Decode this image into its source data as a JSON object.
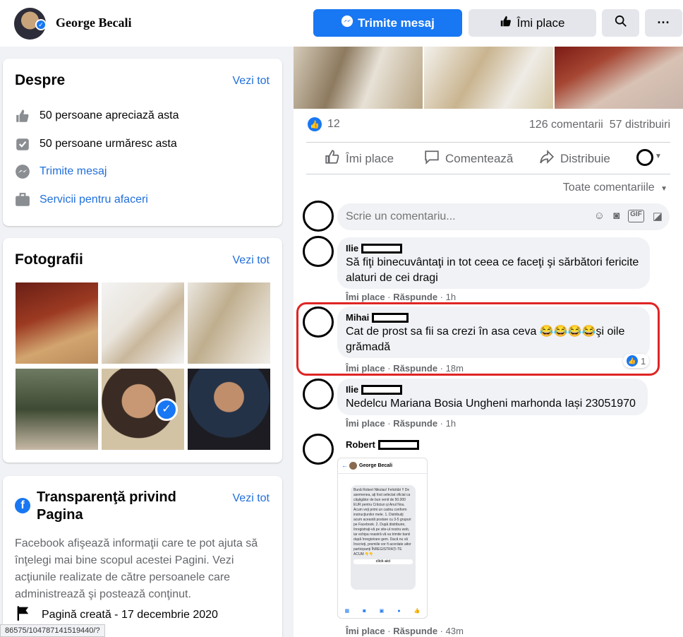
{
  "header": {
    "page_name": "George Becali",
    "send_message_label": "Trimite mesaj",
    "like_label": "Îmi place"
  },
  "about": {
    "title": "Despre",
    "see_all": "Vezi tot",
    "rows": [
      {
        "icon": "thumbs-up-icon",
        "text": "50 persoane apreciază asta"
      },
      {
        "icon": "follow-icon",
        "text": "50 persoane urmăresc asta"
      },
      {
        "icon": "messenger-icon",
        "text": "Trimite mesaj"
      },
      {
        "icon": "briefcase-icon",
        "text": "Servicii pentru afaceri"
      }
    ]
  },
  "photos": {
    "title": "Fotografii",
    "see_all": "Vezi tot"
  },
  "transparency": {
    "title": "Transparenţă privind Pagina",
    "see_all": "Vezi tot",
    "description": "Facebook afişează informaţii care te pot ajuta să înţelegi mai bine scopul acestei Pagini. Vezi acţiunile realizate de către persoanele care administrează şi postează conţinut.",
    "created": "Pagină creată - 17 decembrie 2020"
  },
  "post": {
    "like_count": "12",
    "comments_count": "126 comentarii",
    "shares_count": "57 distribuiri",
    "actions": {
      "like": "Îmi place",
      "comment": "Comentează",
      "share": "Distribuie"
    },
    "sort_label": "Toate comentariile",
    "input_placeholder": "Scrie un comentariu..."
  },
  "comments": [
    {
      "author": "Ilie",
      "text": "Să fiţi binecuvântaţi in tot ceea ce faceţi şi sărbători fericite alaturi de cei dragi",
      "like": "Îmi place",
      "reply": "Răspunde",
      "time": "1h"
    },
    {
      "author": "Mihai",
      "text": "Cat de prost sa fii sa crezi în asa ceva 😂😂😂😂şi oile grămadă",
      "like": "Îmi place",
      "reply": "Răspunde",
      "time": "18m",
      "reactions": "1"
    },
    {
      "author": "Ilie",
      "text": "Nedelcu Mariana Bosia Ungheni marhonda Iași 23051970",
      "like": "Îmi place",
      "reply": "Răspunde",
      "time": "1h"
    },
    {
      "author": "Robert",
      "text": "",
      "like": "Îmi place",
      "reply": "Răspunde",
      "time": "43m"
    }
  ],
  "attached_screenshot": {
    "title": "George Becali",
    "message": "Bună Robert Nikolas! Felicitări !! De asemenea, aţi fost selectat oficial ca câştigător de bun venit de 50.000 EUR pentru Crăciun şi Anul Nou. Acum veţi primi un cadou conform instrucţiunilor mele. 1. Distribuiţi acum această postare cu 3-5 grupuri pe Facebook. 2. După distribuire, înregistraţi-vă pe site-ul nostru web, iar echipa noastră vă va trimite banii după înregistrare gem. Dacă nu vă înscrieţi, premiile vor fi acordate altor participanţi ÎNREGISTRAŢI-TE ACUM 👇👇",
    "link": "click aici"
  },
  "status_url": "86575/104787141519440/?"
}
